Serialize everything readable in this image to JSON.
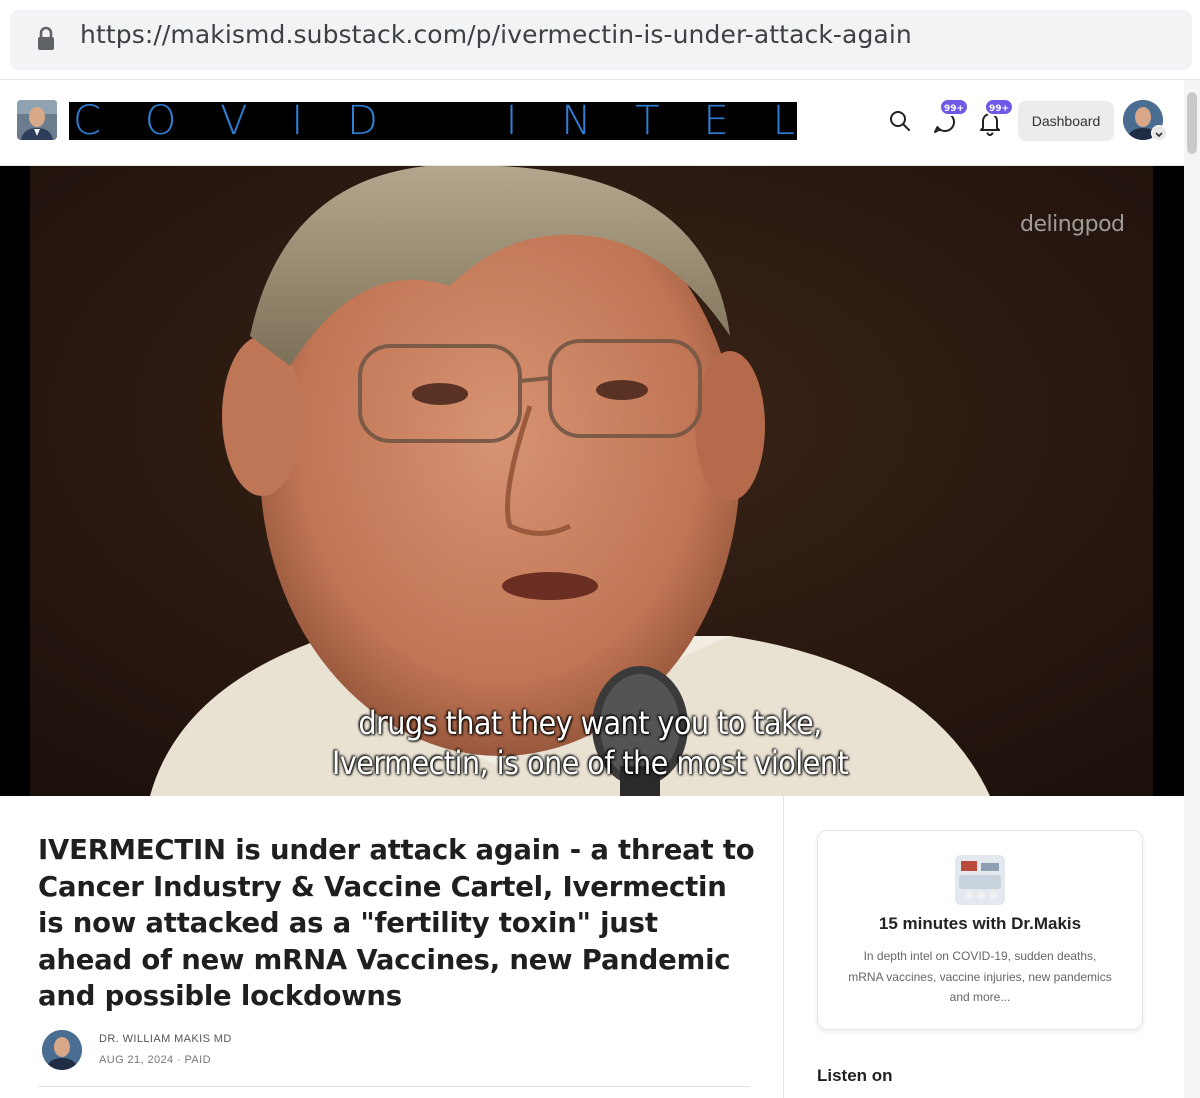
{
  "browser": {
    "url": "https://makismd.substack.com/p/ivermectin-is-under-attack-again",
    "lock_icon": "lock-icon"
  },
  "header": {
    "publication_logo": "publication-avatar",
    "banner_letters": [
      "C",
      "O",
      "V",
      "I",
      "D",
      "",
      "I",
      "N",
      "T",
      "E",
      "L"
    ],
    "search_icon": "search-icon",
    "chat_badge": "99+",
    "notifications_badge": "99+",
    "dashboard_label": "Dashboard",
    "user_avatar": "user-avatar",
    "colors": {
      "banner_text": "#2f7fd6",
      "badge": "#6d5ae6"
    }
  },
  "hero": {
    "watermark": "delingpod",
    "caption_line1": "drugs that they want you to take,",
    "caption_line2": "Ivermectin, is one of the most violent"
  },
  "article": {
    "title": "IVERMECTIN is under attack again - a threat to Cancer Industry & Vaccine Cartel, Ivermectin is now attacked as a \"fertility toxin\" just ahead of new mRNA Vaccines, new Pandemic and possible lockdowns",
    "author": "DR. WILLIAM MAKIS MD",
    "meta": "AUG 21, 2024 · PAID"
  },
  "sidebar": {
    "podcast_title": "15 minutes with Dr.Makis",
    "podcast_description": "In depth intel on COVID-19, sudden deaths, mRNA vaccines, vaccine injuries, new pandemics and more...",
    "listen_on": "Listen on"
  }
}
